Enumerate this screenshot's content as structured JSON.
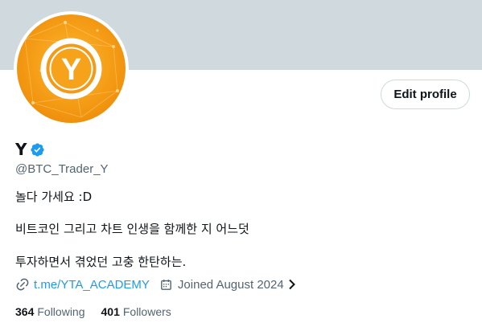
{
  "profile": {
    "display_name": "Y",
    "handle": "@BTC_Trader_Y",
    "avatar_letter": "Y",
    "edit_label": "Edit profile",
    "bio": [
      "놀다 가세요 :D",
      "비트코인 그리고 차트 인생을 함께한 지 어느덧",
      "투자하면서 겪었던 고충 한탄하는."
    ],
    "link": "t.me/YTA_ACADEMY",
    "joined": "Joined August 2024",
    "following_count": "364",
    "following_label": "Following",
    "followers_count": "401",
    "followers_label": "Followers"
  },
  "colors": {
    "banner": "#cfd9de",
    "accent": "#1d9bf0",
    "avatar": "#f7a21b"
  },
  "icons": [
    "verified-badge-icon",
    "link-icon",
    "calendar-icon",
    "chevron-right-icon"
  ]
}
